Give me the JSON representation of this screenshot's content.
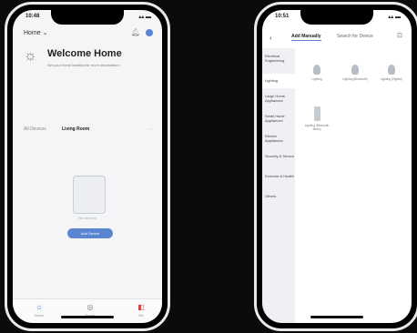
{
  "phone_left": {
    "status": {
      "time": "10:48",
      "icons": "▴▴ ▬"
    },
    "home_selector": "Home ⌄",
    "welcome": "Welcome Home",
    "welcome_sub": "Set your home location for more information ›",
    "tabs": [
      "All Devices",
      "Living Room"
    ],
    "tab_more": "···",
    "empty_text": "No devices",
    "add_button": "Add Device",
    "nav": [
      {
        "icon": "home-icon",
        "label": "Home"
      },
      {
        "icon": "scene-icon",
        "label": "Smart"
      },
      {
        "icon": "me-icon",
        "label": "Me"
      }
    ]
  },
  "phone_right": {
    "status": {
      "time": "10:51",
      "icons": "▴▴ ▬"
    },
    "tabs": [
      "Add Manually",
      "Search for Device"
    ],
    "categories": [
      "Electrical Engineering",
      "Lighting",
      "Large Home Appliances",
      "Small Home Appliances",
      "Kitchen Appliances",
      "Security & Sensor",
      "Exercise & Health",
      "Others"
    ],
    "devices": [
      {
        "label": "Lighting"
      },
      {
        "label": "Lighting (Bluetooth)"
      },
      {
        "label": "Lighting (ZigBee)"
      },
      {
        "label": "Lighting (Bluetooth Mesh)"
      }
    ]
  }
}
